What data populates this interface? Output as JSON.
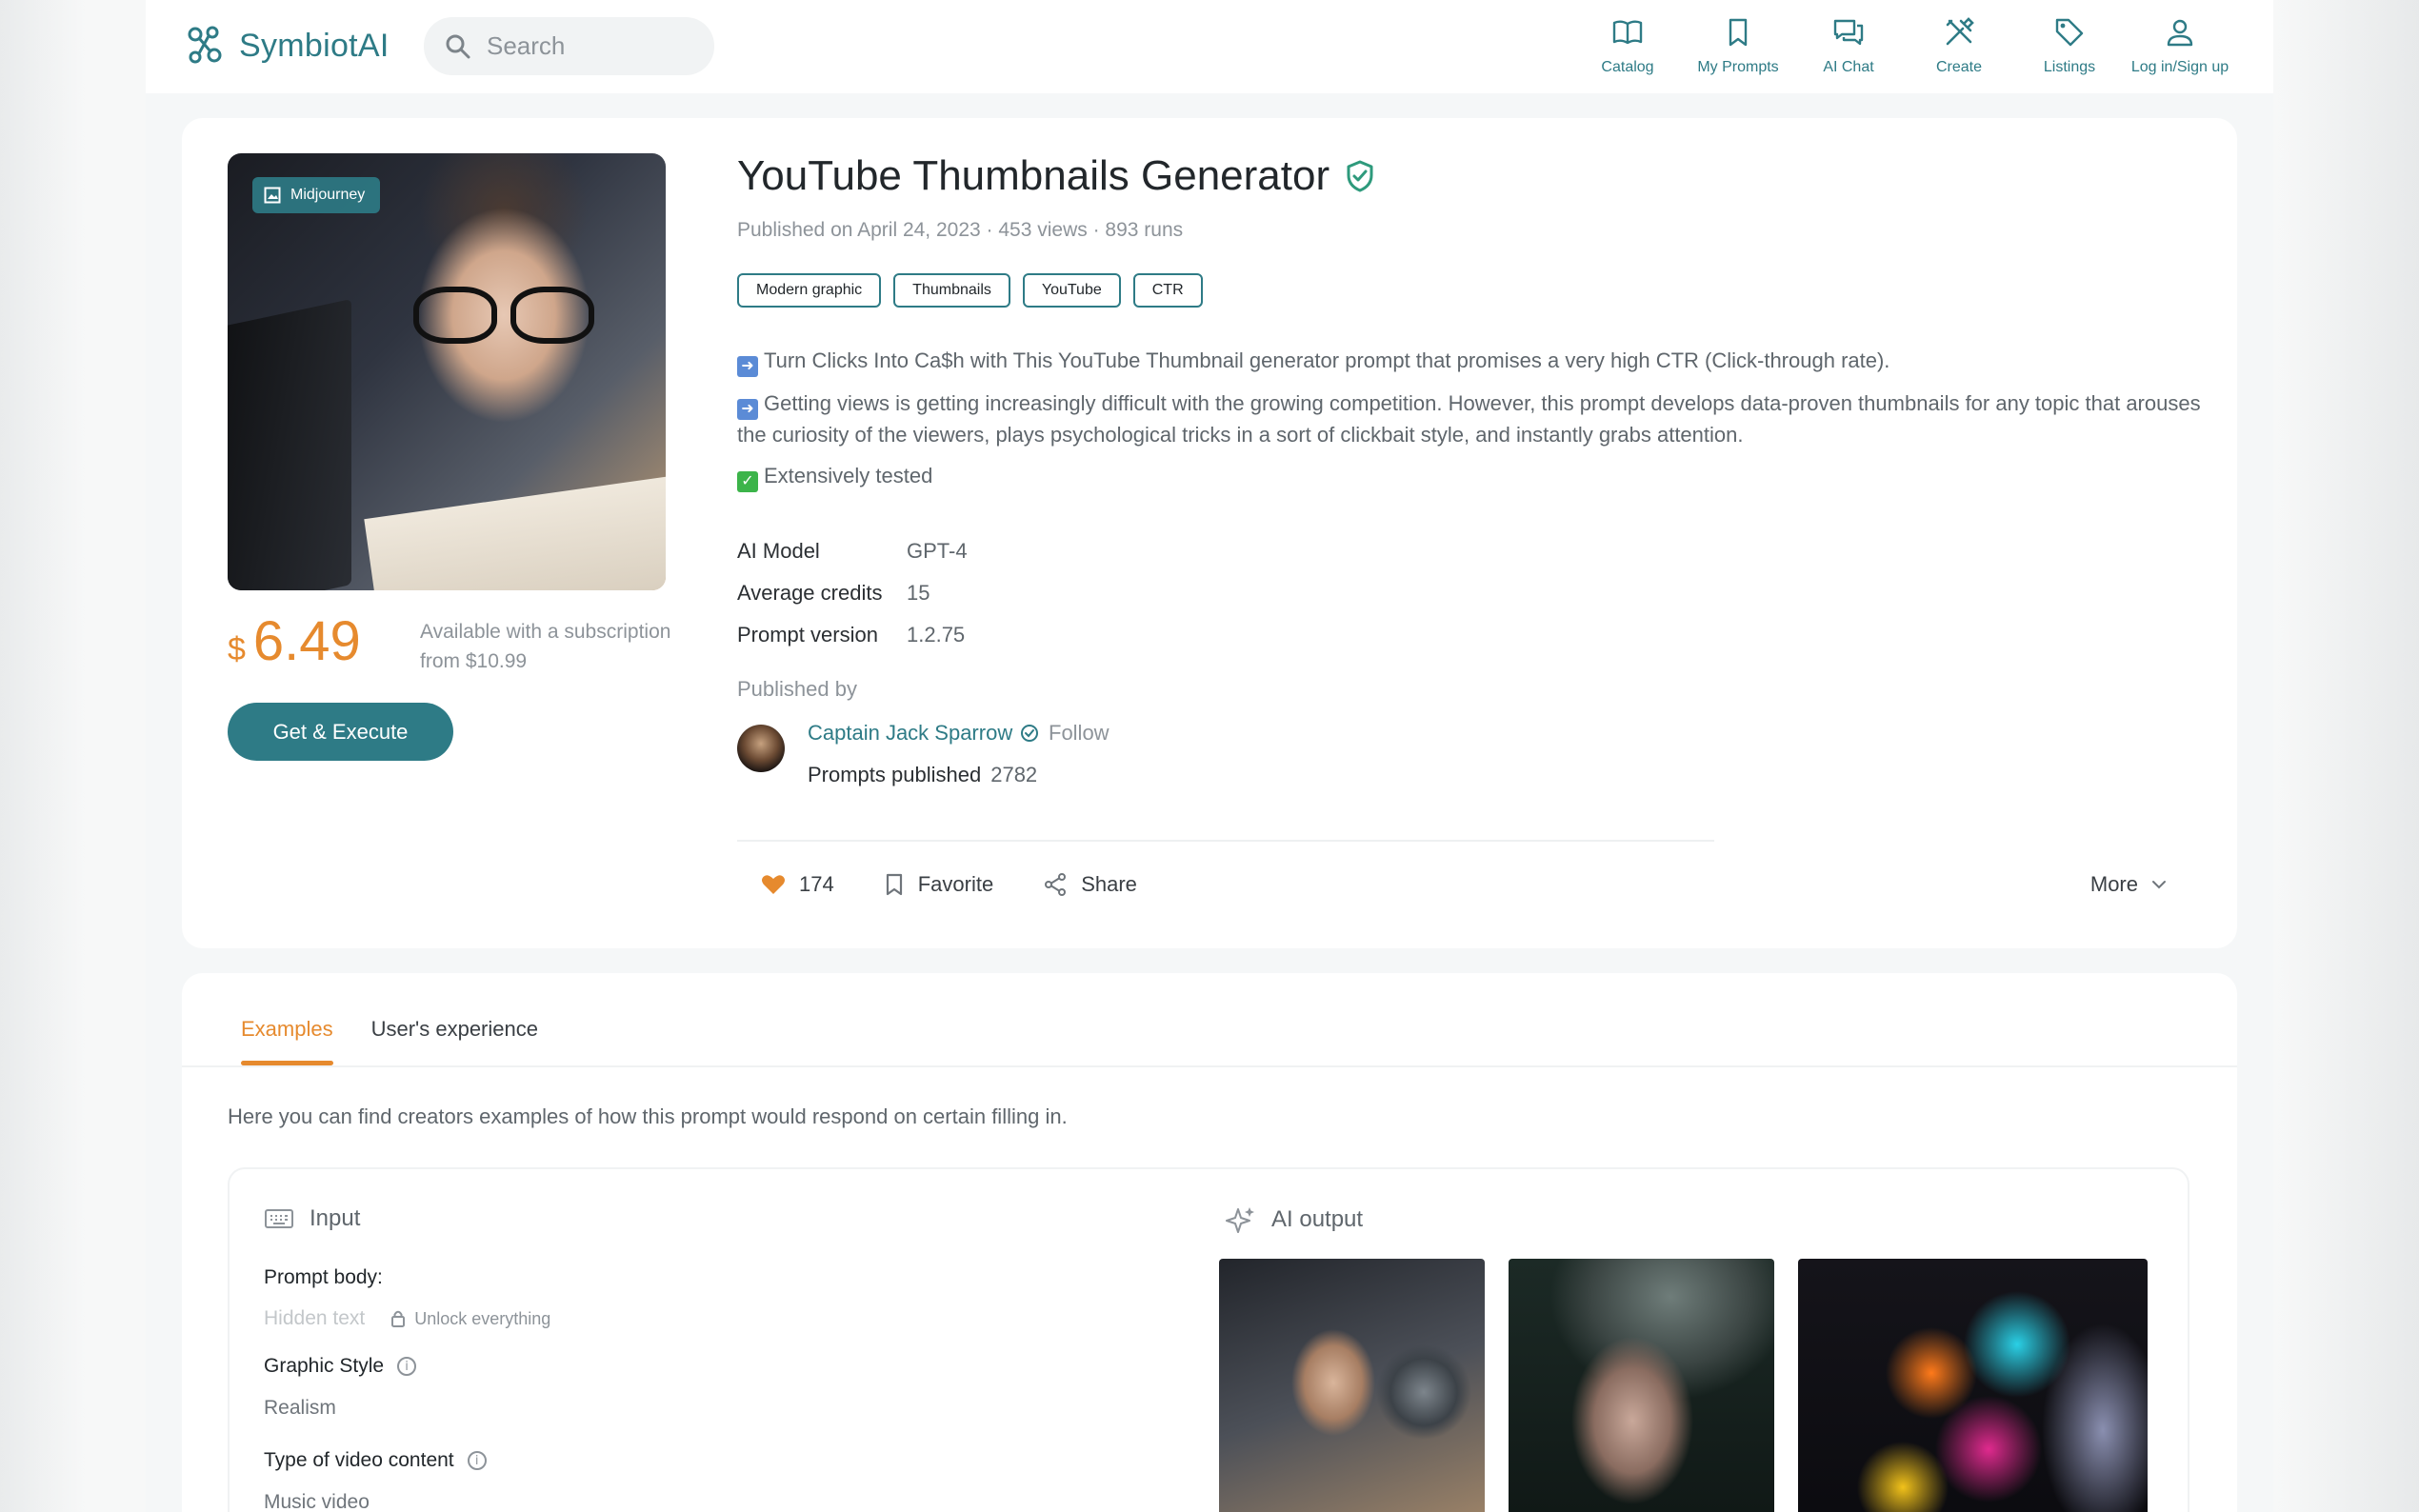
{
  "header": {
    "logo_text": "SymbiotAI",
    "search_placeholder": "Search",
    "nav": [
      {
        "label": "Catalog",
        "icon": "book-icon"
      },
      {
        "label": "My Prompts",
        "icon": "bookmark-icon"
      },
      {
        "label": "AI Chat",
        "icon": "chat-icon"
      },
      {
        "label": "Create",
        "icon": "tools-icon"
      },
      {
        "label": "Listings",
        "icon": "tag-icon"
      },
      {
        "label": "Log in/Sign up",
        "icon": "user-icon"
      }
    ]
  },
  "product": {
    "badge": "Midjourney",
    "title": "YouTube Thumbnails Generator",
    "meta": "Published on April 24, 2023 · 453 views · 893 runs",
    "tags": [
      "Modern graphic",
      "Thumbnails",
      "YouTube",
      "CTR"
    ],
    "description": [
      "Turn Clicks Into Ca$h with This YouTube Thumbnail generator prompt that promises a very high CTR (Click-through rate).",
      "Getting views is getting increasingly difficult with the growing competition. However, this prompt develops data-proven thumbnails for any topic that arouses the curiosity of the viewers, plays psychological tricks in a sort of clickbait style, and instantly grabs attention.",
      "Extensively tested"
    ],
    "properties": [
      {
        "key": "AI Model",
        "value": "GPT-4"
      },
      {
        "key": "Average credits",
        "value": "15"
      },
      {
        "key": "Prompt version",
        "value": "1.2.75"
      }
    ],
    "currency": "$",
    "price": "6.49",
    "subscription_note": "Available with a subscription from $10.99",
    "cta_label": "Get & Execute",
    "published_by_label": "Published by",
    "publisher_name": "Captain Jack Sparrow",
    "follow_label": "Follow",
    "prompts_published_label": "Prompts published",
    "prompts_published_count": "2782",
    "likes": "174",
    "favorite_label": "Favorite",
    "share_label": "Share",
    "more_label": "More"
  },
  "examples": {
    "tabs": [
      "Examples",
      "User's experience"
    ],
    "active_tab": "Examples",
    "intro": "Here you can find creators examples of how this prompt would respond on certain filling in.",
    "input_title": "Input",
    "output_title": "AI output",
    "prompt_body_label": "Prompt body:",
    "hidden_text": "Hidden text",
    "unlock_label": "Unlock everything",
    "fields": [
      {
        "label": "Graphic Style",
        "value": "Realism"
      },
      {
        "label": "Type of video content",
        "value": "Music video"
      }
    ]
  },
  "colors": {
    "brand": "#2e7b86",
    "accent": "#e68a2e"
  }
}
